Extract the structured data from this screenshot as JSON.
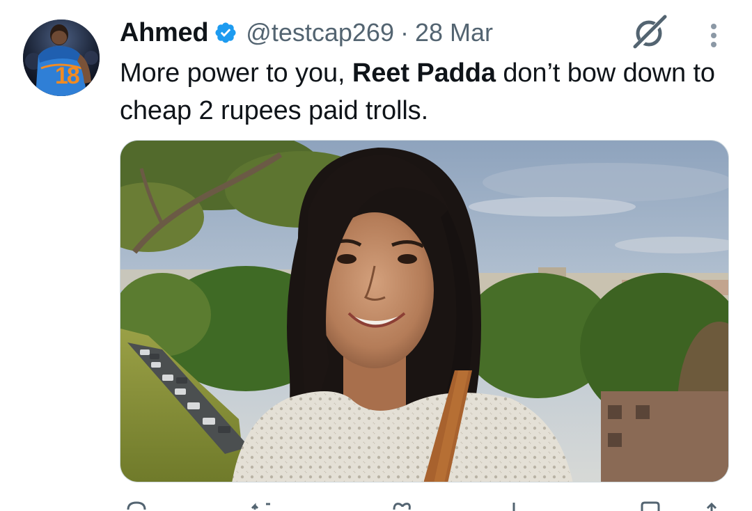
{
  "tweet": {
    "author": {
      "display_name": "Ahmed",
      "verified": true,
      "handle": "@testcap269",
      "avatar_icon": "profile-avatar",
      "jersey_number": "18"
    },
    "separator": "·",
    "date": "28 Mar",
    "text": {
      "part1": "More power to you, ",
      "bold": "Reet Padda",
      "part2": " don’t bow down to cheap 2 rupees paid trolls."
    },
    "header_icons": [
      "grok-icon",
      "more-options-icon"
    ],
    "media": {
      "type": "photo",
      "alt_icon": "photo-of-person-outdoors"
    },
    "actions": [
      "reply-icon",
      "retweet-icon",
      "like-icon",
      "views-icon",
      "bookmark-icon",
      "share-icon"
    ]
  },
  "colors": {
    "text_primary": "#0f1419",
    "text_secondary": "#536471",
    "verified_blue": "#1d9bf0",
    "border": "#cfd9de"
  }
}
